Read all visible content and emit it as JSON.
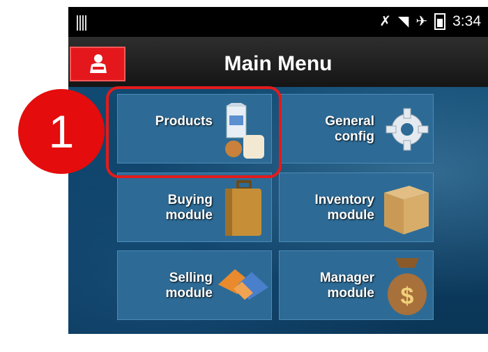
{
  "statusbar": {
    "time": "3:34"
  },
  "appbar": {
    "title": "Main Menu"
  },
  "tiles": {
    "products": {
      "line1": "Products",
      "line2": ""
    },
    "general_config": {
      "line1": "General",
      "line2": "config"
    },
    "buying": {
      "line1": "Buying",
      "line2": "module"
    },
    "inventory": {
      "line1": "Inventory",
      "line2": "module"
    },
    "selling": {
      "line1": "Selling",
      "line2": "module"
    },
    "manager": {
      "line1": "Manager",
      "line2": "module"
    }
  },
  "annotation": {
    "step": "1"
  }
}
